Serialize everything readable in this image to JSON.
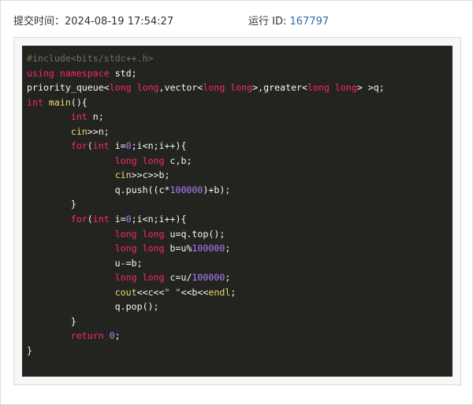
{
  "header": {
    "submit_time_label": "提交时间：",
    "submit_time_value": "2024-08-19 17:54:27",
    "run_id_label": "运行 ID: ",
    "run_id_value": "167797"
  },
  "colors": {
    "link": "#2b6cb0",
    "code_bg": "#23241f",
    "keyword": "#f92672",
    "number": "#ae81ff",
    "string": "#e6db74",
    "comment": "#75715e",
    "type": "#66d9ef"
  },
  "code": {
    "lines": [
      [
        [
          "pre",
          "#include<bits/stdc++.h>"
        ]
      ],
      [
        [
          "kw",
          "using namespace "
        ],
        [
          "plain",
          "std;"
        ]
      ],
      [
        [
          "plain",
          "priority_queue<"
        ],
        [
          "kw",
          "long long"
        ],
        [
          "plain",
          ",vector<"
        ],
        [
          "kw",
          "long long"
        ],
        [
          "plain",
          ">,greater<"
        ],
        [
          "kw",
          "long long"
        ],
        [
          "plain",
          "> >q;"
        ]
      ],
      [
        [
          "kw",
          "int "
        ],
        [
          "fn",
          "main"
        ],
        [
          "plain",
          "(){"
        ]
      ],
      [
        [
          "plain",
          "\t"
        ],
        [
          "kw",
          "int "
        ],
        [
          "plain",
          "n;"
        ]
      ],
      [
        [
          "plain",
          "\t"
        ],
        [
          "fn",
          "cin"
        ],
        [
          "plain",
          ">>n;"
        ]
      ],
      [
        [
          "plain",
          "\t"
        ],
        [
          "kw",
          "for"
        ],
        [
          "plain",
          "("
        ],
        [
          "kw",
          "int "
        ],
        [
          "plain",
          "i="
        ],
        [
          "num",
          "0"
        ],
        [
          "plain",
          ";i<n;i++){"
        ]
      ],
      [
        [
          "plain",
          "\t\t"
        ],
        [
          "kw",
          "long long "
        ],
        [
          "plain",
          "c,b;"
        ]
      ],
      [
        [
          "plain",
          "\t\t"
        ],
        [
          "fn",
          "cin"
        ],
        [
          "plain",
          ">>c>>b;"
        ]
      ],
      [
        [
          "plain",
          "\t\tq.push((c*"
        ],
        [
          "num",
          "100000"
        ],
        [
          "plain",
          ")+b);"
        ]
      ],
      [
        [
          "plain",
          "\t}"
        ]
      ],
      [
        [
          "plain",
          "\t"
        ],
        [
          "kw",
          "for"
        ],
        [
          "plain",
          "("
        ],
        [
          "kw",
          "int "
        ],
        [
          "plain",
          "i="
        ],
        [
          "num",
          "0"
        ],
        [
          "plain",
          ";i<n;i++){"
        ]
      ],
      [
        [
          "plain",
          "\t\t"
        ],
        [
          "kw",
          "long long "
        ],
        [
          "plain",
          "u=q.top();"
        ]
      ],
      [
        [
          "plain",
          "\t\t"
        ],
        [
          "kw",
          "long long "
        ],
        [
          "plain",
          "b=u%"
        ],
        [
          "num",
          "100000"
        ],
        [
          "plain",
          ";"
        ]
      ],
      [
        [
          "plain",
          "\t\tu-=b;"
        ]
      ],
      [
        [
          "plain",
          "\t\t"
        ],
        [
          "kw",
          "long long "
        ],
        [
          "plain",
          "c=u/"
        ],
        [
          "num",
          "100000"
        ],
        [
          "plain",
          ";"
        ]
      ],
      [
        [
          "plain",
          "\t\t"
        ],
        [
          "fn",
          "cout"
        ],
        [
          "plain",
          "<<c<<"
        ],
        [
          "str",
          "\" \""
        ],
        [
          "plain",
          "<<b<<"
        ],
        [
          "fn",
          "endl"
        ],
        [
          "plain",
          ";"
        ]
      ],
      [
        [
          "plain",
          "\t\tq.pop();"
        ]
      ],
      [
        [
          "plain",
          "\t}"
        ]
      ],
      [
        [
          "plain",
          "\t"
        ],
        [
          "kw",
          "return "
        ],
        [
          "num",
          "0"
        ],
        [
          "plain",
          ";"
        ]
      ],
      [
        [
          "plain",
          "}"
        ]
      ]
    ]
  }
}
